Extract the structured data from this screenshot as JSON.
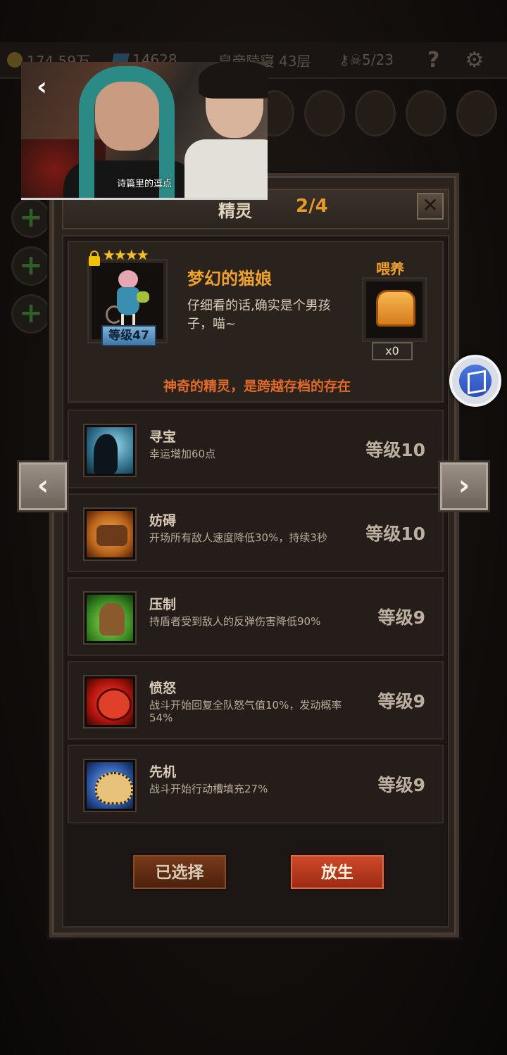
{
  "topbar": {
    "gold": "174.59万",
    "gems": "14628",
    "floor": "皇帝陵寝 43层",
    "keys": "5/23",
    "help": "?"
  },
  "video": {
    "caption": "诗篇里的逗点"
  },
  "dialog": {
    "title": "精灵",
    "count": "2/4",
    "close": "✕"
  },
  "spirit": {
    "stars": "★★★★",
    "level_badge": "等级47",
    "name": "梦幻的猫娘",
    "description": "仔细看的话,确实是个男孩子，喵~",
    "feed_label": "喂养",
    "feed_count": "x0",
    "tagline": "神奇的精灵，是跨越存档的存在"
  },
  "skills": [
    {
      "name": "寻宝",
      "desc": "幸运增加60点",
      "level": "等级10",
      "icon": "treasure-silhouette-icon"
    },
    {
      "name": "妨碍",
      "desc": "开场所有敌人速度降低30%，持续3秒",
      "level": "等级10",
      "icon": "chained-boot-icon"
    },
    {
      "name": "压制",
      "desc": "持盾者受到敌人的反弹伤害降低90%",
      "level": "等级9",
      "icon": "beast-claw-icon"
    },
    {
      "name": "愤怒",
      "desc": "战斗开始回复全队怒气值10%，发动概率54%",
      "level": "等级9",
      "icon": "roaring-panther-icon"
    },
    {
      "name": "先机",
      "desc": "战斗开始行动槽填充27%",
      "level": "等级9",
      "icon": "leopard-icon"
    }
  ],
  "buttons": {
    "selected": "已选择",
    "release": "放生"
  },
  "nav": {
    "prev": "‹",
    "next": "›"
  },
  "colors": {
    "accent_orange": "#f0a22e",
    "tagline_red": "#e06a2a",
    "release_button": "#d0492a"
  }
}
